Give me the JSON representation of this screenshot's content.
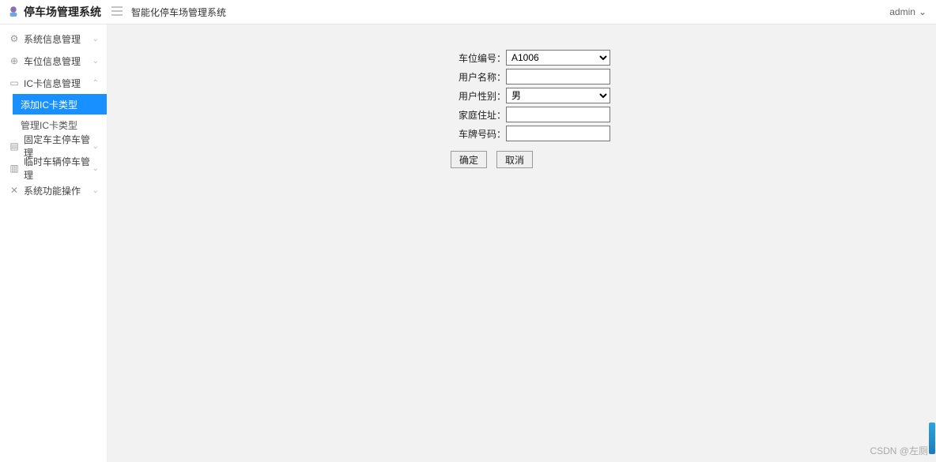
{
  "brand": {
    "title": "停车场管理系统"
  },
  "header": {
    "breadcrumb": "智能化停车场管理系统",
    "user_name": "admin"
  },
  "sidebar": {
    "items": [
      {
        "icon": "⚙",
        "label": "系统信息管理",
        "arrow": "⌄"
      },
      {
        "icon": "⊕",
        "label": "车位信息管理",
        "arrow": "⌄"
      },
      {
        "icon": "▭",
        "label": "IC卡信息管理",
        "arrow": "⌃",
        "children": [
          {
            "label": "添加IC卡类型",
            "active": true
          },
          {
            "label": "管理IC卡类型",
            "active": false
          }
        ]
      },
      {
        "icon": "▤",
        "label": "固定车主停车管理",
        "arrow": "⌄"
      },
      {
        "icon": "▥",
        "label": "临时车辆停车管理",
        "arrow": "⌄"
      },
      {
        "icon": "✕",
        "label": "系统功能操作",
        "arrow": "⌄"
      }
    ]
  },
  "form": {
    "fields": {
      "parking_no": {
        "label": "车位编号：",
        "value": "A1006"
      },
      "user_name": {
        "label": "用户名称：",
        "value": ""
      },
      "user_gender": {
        "label": "用户性别：",
        "value": "男"
      },
      "address": {
        "label": "家庭住址：",
        "value": ""
      },
      "plate_no": {
        "label": "车牌号码：",
        "value": ""
      }
    },
    "buttons": {
      "ok": "确定",
      "cancel": "取消"
    }
  },
  "watermark": "CSDN @左厕"
}
